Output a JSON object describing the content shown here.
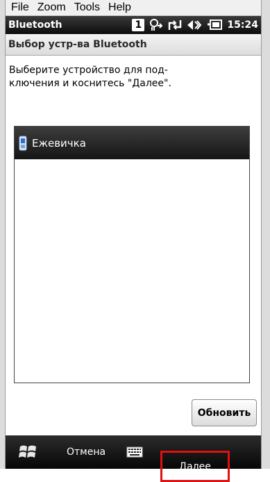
{
  "menu": {
    "items": [
      "File",
      "Zoom",
      "Tools",
      "Help"
    ]
  },
  "status": {
    "app_title": "Bluetooth",
    "badge": "1",
    "time": "15:24"
  },
  "page": {
    "header": "Выбор устр-ва Bluetooth",
    "instruction_line1": "Выберите устройство для под-",
    "instruction_line2": "ключения и коснитесь \"Далее\"."
  },
  "device_list": {
    "items": [
      {
        "label": "Ежевичка"
      }
    ]
  },
  "buttons": {
    "refresh": "Обновить"
  },
  "softkeys": {
    "left": "Отмена",
    "right": "Далее"
  },
  "colors": {
    "highlight_border": "#e01010",
    "header_bar": "#1a1a1a"
  },
  "icons": [
    "windows-start-icon",
    "keyboard-icon",
    "phone-device-icon",
    "signal-icon",
    "sync-icon",
    "volume-icon",
    "battery-icon"
  ]
}
